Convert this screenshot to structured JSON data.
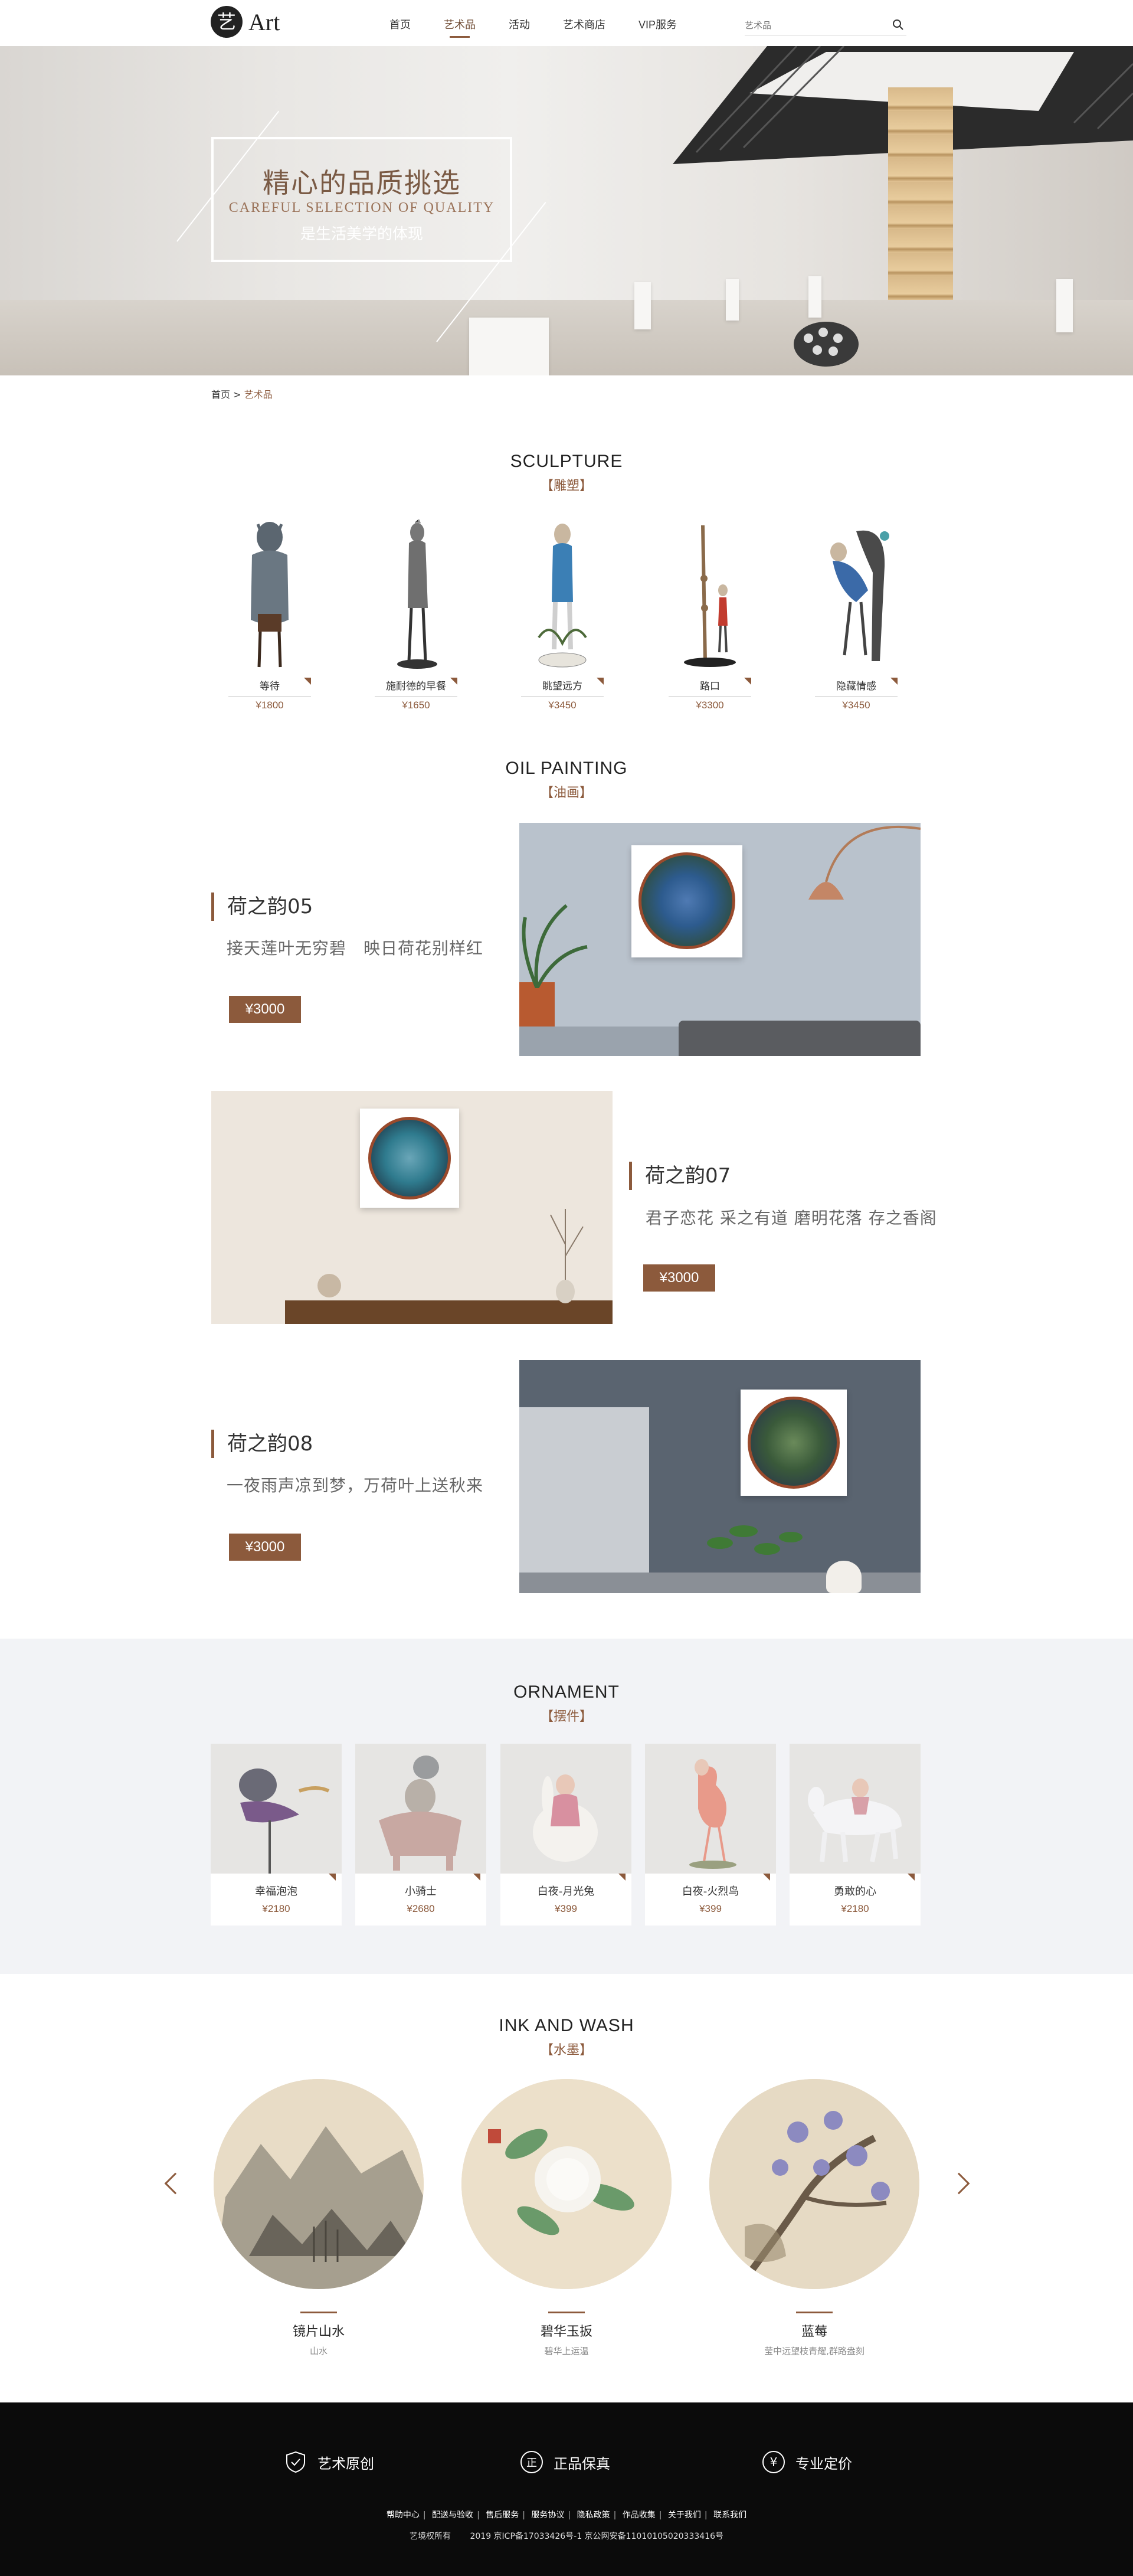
{
  "header": {
    "logo_mark": "艺",
    "logo_text": "Art",
    "nav": [
      "首页",
      "艺术品",
      "活动",
      "艺术商店",
      "VIP服务"
    ],
    "active_nav": "艺术品",
    "search_placeholder": "艺术品",
    "search_icon": "search-icon"
  },
  "hero": {
    "title": "精心的品质挑选",
    "subtitle": "CAREFUL SELECTION OF QUALITY",
    "tagline": "是生活美学的体现"
  },
  "breadcrumb": {
    "home": "首页",
    "separator": ">",
    "current": "艺术品"
  },
  "sculpture": {
    "title_en": "SCULPTURE",
    "title_cn": "【雕塑】",
    "items": [
      {
        "name": "等待",
        "price": "¥1800"
      },
      {
        "name": "施耐德的早餐",
        "price": "¥1650"
      },
      {
        "name": "眺望远方",
        "price": "¥3450"
      },
      {
        "name": "路口",
        "price": "¥3300"
      },
      {
        "name": "隐藏情感",
        "price": "¥3450"
      }
    ]
  },
  "oil": {
    "title_en": "OIL PAINTING",
    "title_cn": "【油画】",
    "items": [
      {
        "name": "荷之韵05",
        "desc": "接天莲叶无穷碧　映日荷花别样红",
        "price": "¥3000"
      },
      {
        "name": "荷之韵07",
        "desc": "君子恋花 采之有道 磨明花落 存之香阁",
        "price": "¥3000"
      },
      {
        "name": "荷之韵08",
        "desc": "一夜雨声凉到梦，万荷叶上送秋来",
        "price": "¥3000"
      }
    ]
  },
  "ornament": {
    "title_en": "ORNAMENT",
    "title_cn": "【摆件】",
    "items": [
      {
        "name": "幸福泡泡",
        "price": "¥2180"
      },
      {
        "name": "小骑士",
        "price": "¥2680"
      },
      {
        "name": "白夜-月光兔",
        "price": "¥399"
      },
      {
        "name": "白夜-火烈鸟",
        "price": "¥399"
      },
      {
        "name": "勇敢的心",
        "price": "¥2180"
      }
    ]
  },
  "ink": {
    "title_en": "INK AND WASH",
    "title_cn": "【水墨】",
    "items": [
      {
        "name": "镜片山水",
        "sub": "山水"
      },
      {
        "name": "碧华玉扳",
        "sub": "碧华上运温"
      },
      {
        "name": "蓝莓",
        "sub": "莹中远望枝青耀,群路盎刻"
      }
    ]
  },
  "footer": {
    "features": [
      {
        "icon": "shield-icon",
        "label": "艺术原创"
      },
      {
        "icon": "authentic-icon",
        "label": "正品保真"
      },
      {
        "icon": "yen-icon",
        "label": "专业定价"
      }
    ],
    "links": [
      "帮助中心",
      "配送与验收",
      "售后服务",
      "服务协议",
      "隐私政策",
      "作品收集",
      "关于我们",
      "联系我们"
    ],
    "copyright": "艺境权所有",
    "icp": "2019 京ICP备17033426号-1 京公网安备11010105020333416号"
  },
  "colors": {
    "accent": "#8c5a3c",
    "footer_bg": "#0b0b0b",
    "ornament_bg": "#f2f3f6"
  }
}
